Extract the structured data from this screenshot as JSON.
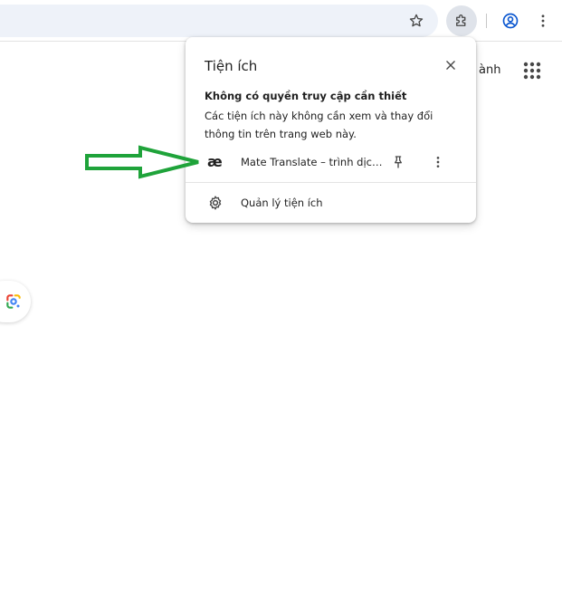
{
  "toolbar": {
    "bookmark_icon": "star-icon",
    "extensions_icon": "puzzle-icon",
    "profile_icon": "profile-icon",
    "menu_icon": "kebab-menu-icon"
  },
  "page": {
    "partial_text": "ành",
    "apps_icon": "apps-grid-icon",
    "lens_icon": "google-lens-icon"
  },
  "popup": {
    "title": "Tiện ích",
    "section_heading": "Không có quyền truy cập cần thiết",
    "section_description": "Các tiện ích này không cần xem và thay đổi thông tin trên trang web này.",
    "extension": {
      "logo_text": "æ",
      "name": "Mate Translate – trình dịch,..."
    },
    "manage_label": "Quản lý tiện ích"
  },
  "colors": {
    "accent_blue": "#0b57d0",
    "annotation_green": "#1fa33a",
    "omnibox_bg": "#eef2f9"
  }
}
